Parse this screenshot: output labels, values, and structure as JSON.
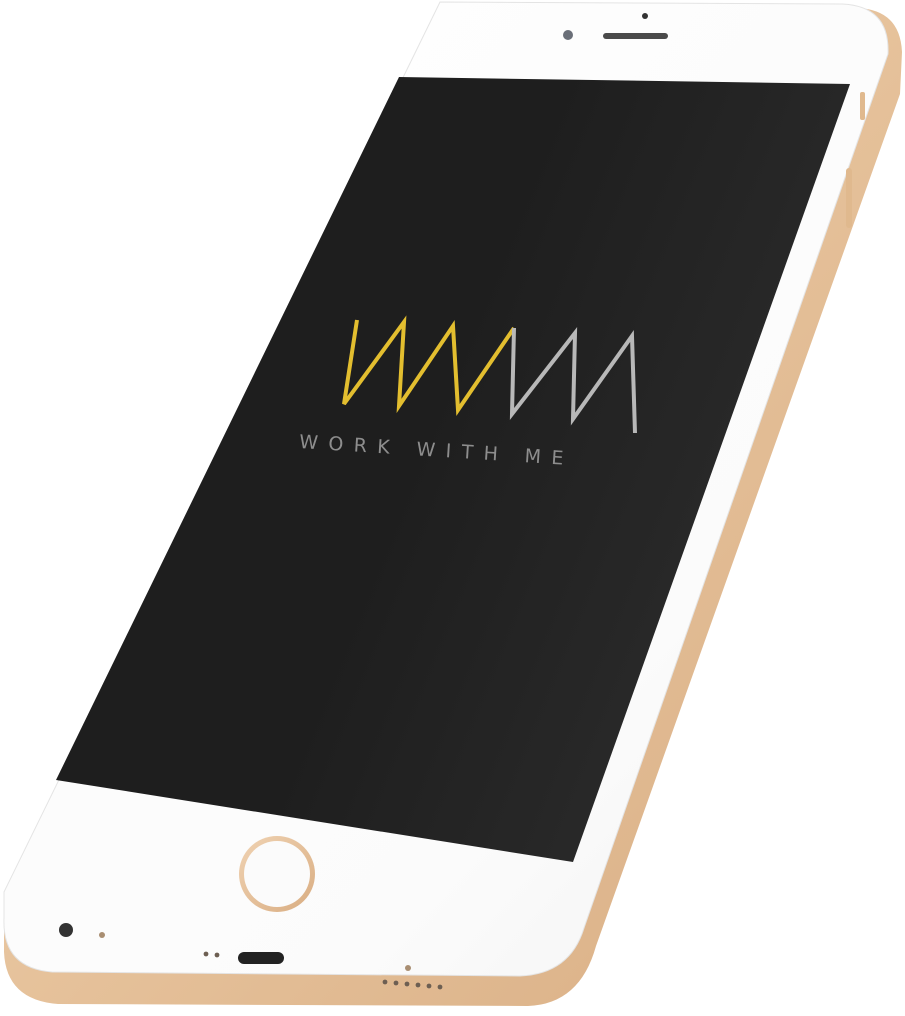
{
  "screen": {
    "tagline": "WORK WITH ME",
    "logo_icon": "wwm-zigzag-logo",
    "colors": {
      "background": "#1e1e1e",
      "logo_gold": "#e3be2f",
      "logo_light": "#b8b8b8",
      "logo_mid": "#c9c9c9",
      "tagline": "#8d8d8d"
    }
  },
  "device": {
    "model_icon": "smartphone-icon",
    "finish_color": "#e9c9a6",
    "bezel_color": "#fbfbfb"
  }
}
